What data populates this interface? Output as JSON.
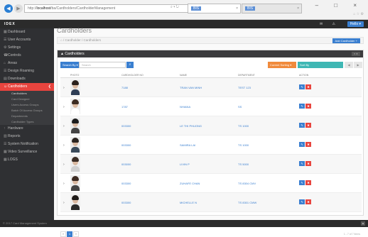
{
  "browser": {
    "url_prefix": "http://",
    "url_host": "localhost",
    "url_path": "/ba/Cardholders/CardholderManagement",
    "url_actions": "⌕ ▾ ↻",
    "tabs": [
      {
        "label": "BIS",
        "close": "×"
      },
      {
        "label": "BIS",
        "close": "×"
      }
    ],
    "window_controls": "– □ ×",
    "toolbar_icons": "⌂ ☆ ⚙"
  },
  "header": {
    "logo": "IDEX",
    "icons": "✉ ⚠",
    "user_label": "Hello ▾"
  },
  "sidebar": {
    "items": [
      {
        "icon": "▦",
        "label": "Dashboard"
      },
      {
        "icon": "☰",
        "label": "User Accounts"
      },
      {
        "icon": "⚙",
        "label": "Settings"
      },
      {
        "icon": "☎",
        "label": "Controls"
      },
      {
        "icon": "⌂",
        "label": "Areas"
      },
      {
        "icon": "☰",
        "label": "Design Roaming"
      },
      {
        "icon": "▤",
        "label": "Downloads"
      },
      {
        "icon": "☺",
        "label": "Cardholders",
        "active": true,
        "caret": "❮"
      }
    ],
    "sub_items": [
      {
        "label": "Cardholders",
        "current": true
      },
      {
        "label": "Card Designer"
      },
      {
        "label": "Users Access Groups"
      },
      {
        "label": "Batch Of Access Groups"
      },
      {
        "label": "Departments"
      },
      {
        "label": "Cardholder Types"
      }
    ],
    "items_after": [
      {
        "icon": "↑",
        "label": "Hardware"
      },
      {
        "icon": "▥",
        "label": "Reports"
      },
      {
        "icon": "☰",
        "label": "System Notification"
      },
      {
        "icon": "▦",
        "label": "Video Surveillance"
      },
      {
        "icon": "▦",
        "label": "LOGS"
      }
    ]
  },
  "content": {
    "page_title": "Cardholders",
    "breadcrumb": "⌂ / Cardholder / Cardholders",
    "add_button": "Add Cardholder +",
    "panel_title": "▲ Cardholders",
    "panel_tools": "≡ ✕",
    "filter_select": "Search By ▾",
    "search_placeholder": "Search",
    "search_icon": "⌕",
    "sort_button": "Current Sorting ▾",
    "sort_dropdown": "Sort By",
    "pager_buttons": [
      "◀",
      "▶"
    ],
    "columns": [
      "PHOTO",
      "CARDHOLDER NO",
      "NAME",
      "DEPARTMENT",
      "ACTION"
    ],
    "rows": [
      {
        "card": "7188",
        "name": "TRAN VAN MINH",
        "dept": "TEST 123",
        "hair": "#2a1f1a",
        "body": "#2e3d55"
      },
      {
        "card": "1787",
        "name": "NHIANA",
        "dept": "SS",
        "hair": "#3b2a20",
        "body": "#ffffff"
      },
      {
        "card": "003300",
        "name": "LE THI PHUONG",
        "dept": "TS 1000",
        "hair": "#1c1c1c",
        "body": "#444444"
      },
      {
        "card": "003300",
        "name": "SAMIRA LAI",
        "dept": "TS 1000",
        "hair": "#2b2420",
        "body": "#3a4a5a"
      },
      {
        "card": "003000",
        "name": "LIVIN P",
        "dept": "TS 5000",
        "hair": "#3a2c24",
        "body": "#cfcfcf"
      },
      {
        "card": "003300",
        "name": "ZUHAFE CHAN",
        "dept": "TS 8304 CMV",
        "hair": "#3d2b22",
        "body": "#444444"
      },
      {
        "card": "003300",
        "name": "MICHELLE N",
        "dept": "TS 8301 CMW",
        "hair": "#1e1a18",
        "body": "#2a2a2a"
      }
    ],
    "action_edit": "✎",
    "action_delete": "✖",
    "pager": [
      "«",
      "1",
      "»"
    ],
    "pager_info": "1 - 7 of 7 items"
  },
  "footer": {
    "text": "© 2017 Card Management System",
    "up": "▲"
  },
  "colors": {
    "accent": "#3a7fd0",
    "danger": "#e8443e",
    "sort": "#f08a3c",
    "teal": "#3fb7b4",
    "sidebar": "#2f3033"
  }
}
